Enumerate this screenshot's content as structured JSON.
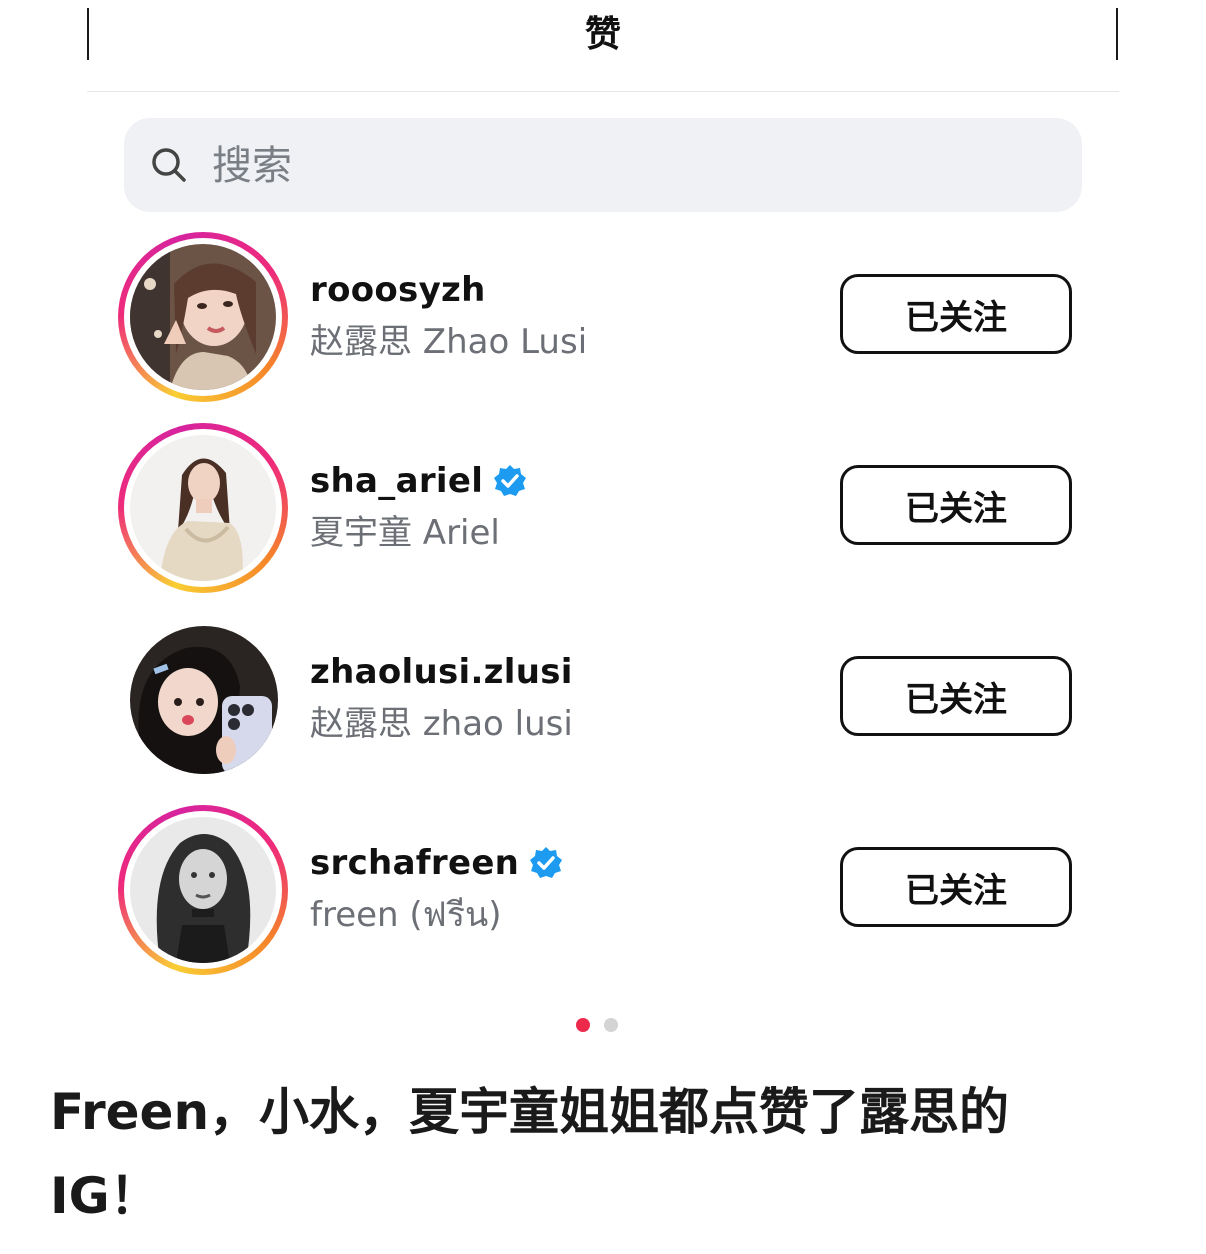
{
  "header": {
    "title": "赞"
  },
  "search": {
    "placeholder": "搜索"
  },
  "users": [
    {
      "username": "rooosyzh",
      "display_name": "赵露思 Zhao Lusi",
      "verified": false,
      "story_ring": true,
      "button": "已关注"
    },
    {
      "username": "sha_ariel",
      "display_name": "夏宇童 Ariel",
      "verified": true,
      "story_ring": true,
      "button": "已关注"
    },
    {
      "username": "zhaolusi.zlusi",
      "display_name": "赵露思 zhao lusi",
      "verified": false,
      "story_ring": false,
      "button": "已关注"
    },
    {
      "username": "srchafreen",
      "display_name": "freen (ฟรีน)",
      "verified": true,
      "story_ring": true,
      "button": "已关注"
    }
  ],
  "pager": {
    "count": 2,
    "active": 0
  },
  "caption": {
    "line1": "Freen，小水，夏宇童姐姐都点赞了露思的",
    "line2": "IG！"
  },
  "colors": {
    "verified": "#1d9bf0",
    "pager_active": "#ed2a4b",
    "search_bg": "#eff1f4"
  },
  "icons": {
    "search": "search-icon",
    "verified": "verified-badge-icon"
  }
}
